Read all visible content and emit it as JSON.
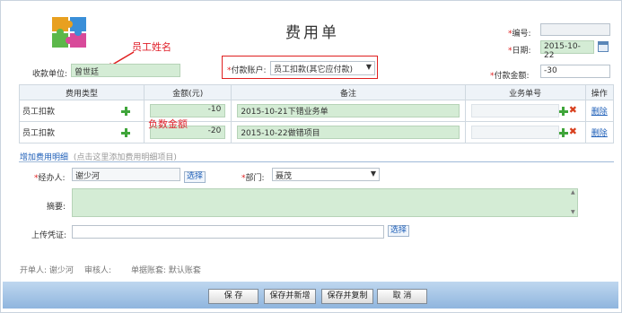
{
  "title": "费用单",
  "annotations": {
    "employee_name": "员工姓名",
    "negative_amount": "负数金额"
  },
  "header": {
    "number_label": "编号:",
    "number_value": "",
    "date_label": "日期:",
    "date_value": "2015-10-22",
    "receiver_label": "收款单位:",
    "receiver_value": "曾世廷",
    "account_label": "付款账户:",
    "account_value": "员工扣款(其它应付款)",
    "amount_label": "付款金额:",
    "amount_value": "-30"
  },
  "table": {
    "columns": [
      "费用类型",
      "金额(元)",
      "备注",
      "业务单号",
      "操作"
    ],
    "rows": [
      {
        "type": "员工扣款",
        "amount": "-10",
        "note": "2015-10-21下错业务单",
        "order": "",
        "action": "删除"
      },
      {
        "type": "员工扣款",
        "amount": "-20",
        "note": "2015-10-22做错项目",
        "order": "",
        "action": "删除"
      }
    ]
  },
  "add_detail": {
    "link": "增加费用明细",
    "hint": "(点击这里添加费用明细项目)"
  },
  "handler": {
    "label": "经办人:",
    "value": "谢少河",
    "select_label": "选择"
  },
  "department": {
    "label": "部门:",
    "value": "聂茂"
  },
  "summary": {
    "label": "摘要:",
    "value": ""
  },
  "upload": {
    "label": "上传凭证:",
    "value": "",
    "select_label": "选择"
  },
  "footer": {
    "creator": "开单人: 谢少河",
    "reviewer": "审核人:",
    "account_set": "单据账套: 默认账套"
  },
  "buttons": {
    "save": "保 存",
    "save_new": "保存并新增",
    "save_copy": "保存并复制",
    "cancel": "取 消"
  },
  "colors": {
    "accent_red": "#e02020",
    "field_green": "#d4ecd5",
    "button_bar": "#9fc0e4"
  }
}
